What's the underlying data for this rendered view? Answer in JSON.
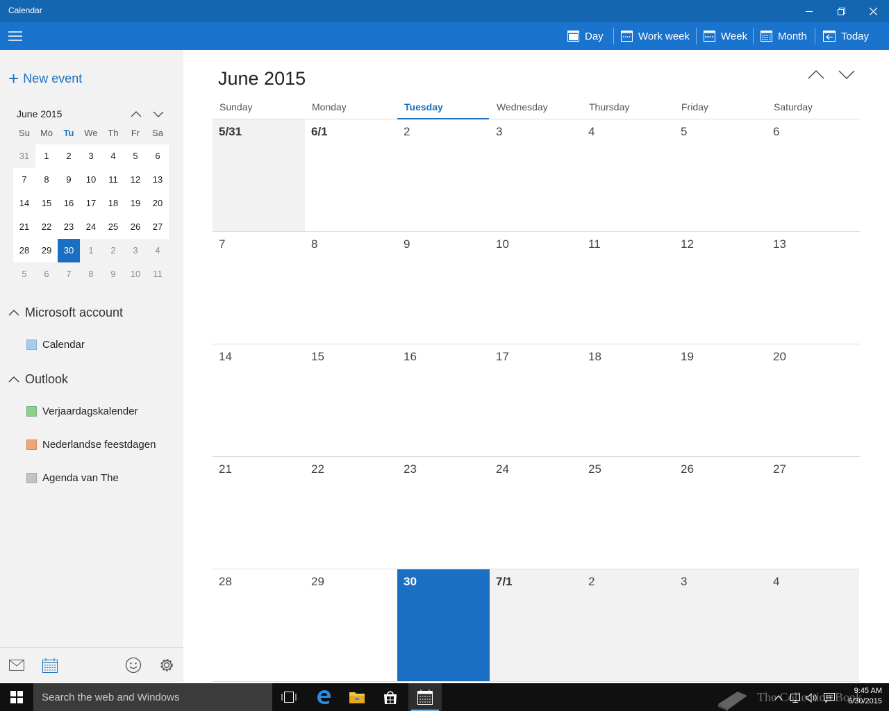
{
  "window": {
    "title": "Calendar"
  },
  "toolbar": {
    "day_label": "Day",
    "workweek_label": "Work week",
    "week_label": "Week",
    "month_label": "Month",
    "today_label": "Today"
  },
  "sidebar": {
    "new_event_label": "New event",
    "mini_calendar": {
      "title": "June 2015",
      "weekday_headers": [
        "Su",
        "Mo",
        "Tu",
        "We",
        "Th",
        "Fr",
        "Sa"
      ],
      "weeks": [
        [
          "31",
          "1",
          "2",
          "3",
          "4",
          "5",
          "6"
        ],
        [
          "7",
          "8",
          "9",
          "10",
          "11",
          "12",
          "13"
        ],
        [
          "14",
          "15",
          "16",
          "17",
          "18",
          "19",
          "20"
        ],
        [
          "21",
          "22",
          "23",
          "24",
          "25",
          "26",
          "27"
        ],
        [
          "28",
          "29",
          "30",
          "1",
          "2",
          "3",
          "4"
        ],
        [
          "5",
          "6",
          "7",
          "8",
          "9",
          "10",
          "11"
        ]
      ],
      "selected": "30"
    },
    "groups": [
      {
        "name": "Microsoft account",
        "calendars": [
          {
            "name": "Calendar",
            "color": "#a6cdf0"
          }
        ]
      },
      {
        "name": "Outlook",
        "calendars": [
          {
            "name": "Verjaardagskalender",
            "color": "#8bd08f"
          },
          {
            "name": "Nederlandse feestdagen",
            "color": "#f2a56f"
          },
          {
            "name": "Agenda van The",
            "color": "#c3c3c3"
          }
        ]
      }
    ]
  },
  "main": {
    "month_title": "June 2015",
    "weekday_headers": [
      "Sunday",
      "Monday",
      "Tuesday",
      "Wednesday",
      "Thursday",
      "Friday",
      "Saturday"
    ],
    "weeks": [
      [
        "5/31",
        "6/1",
        "2",
        "3",
        "4",
        "5",
        "6"
      ],
      [
        "7",
        "8",
        "9",
        "10",
        "11",
        "12",
        "13"
      ],
      [
        "14",
        "15",
        "16",
        "17",
        "18",
        "19",
        "20"
      ],
      [
        "21",
        "22",
        "23",
        "24",
        "25",
        "26",
        "27"
      ],
      [
        "28",
        "29",
        "30",
        "7/1",
        "2",
        "3",
        "4"
      ]
    ],
    "today": "30"
  },
  "taskbar": {
    "search_placeholder": "Search the web and Windows",
    "watermark": "The Collection Book",
    "clock_time": "9:45 AM",
    "clock_date": "6/30/2015"
  },
  "colors": {
    "titlebar": "#1566b0",
    "toolbar": "#1a73cc",
    "accent": "#1a6fc2"
  }
}
